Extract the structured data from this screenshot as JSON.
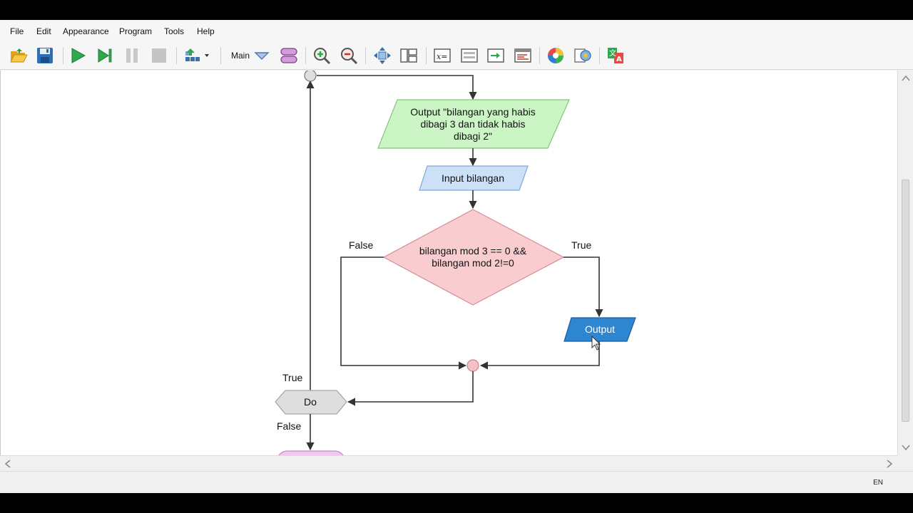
{
  "menu": {
    "file": "File",
    "edit": "Edit",
    "appearance": "Appearance",
    "program": "Program",
    "tools": "Tools",
    "help": "Help"
  },
  "toolbar": {
    "function_name": "Main"
  },
  "flowchart": {
    "output_prompt": [
      "Output \"bilangan yang habis",
      "dibagi 3 dan tidak habis",
      "dibagi 2\""
    ],
    "input": "Input bilangan",
    "condition": [
      "bilangan mod 3 == 0 &&",
      "bilangan mod 2!=0"
    ],
    "false_label": "False",
    "true_label": "True",
    "output": "Output",
    "loop": "Do",
    "loop_true": "True",
    "loop_false": "False"
  },
  "status": {
    "language": "EN"
  },
  "colors": {
    "output_prompt_fill": "#ccf5c6",
    "input_fill": "#cce0f7",
    "condition_fill": "#f9cdd0",
    "output_fill": "#2e86d0",
    "loop_fill": "#dedede",
    "end_fill": "#f1c9f0",
    "merge_fill": "#f4c2c6"
  }
}
